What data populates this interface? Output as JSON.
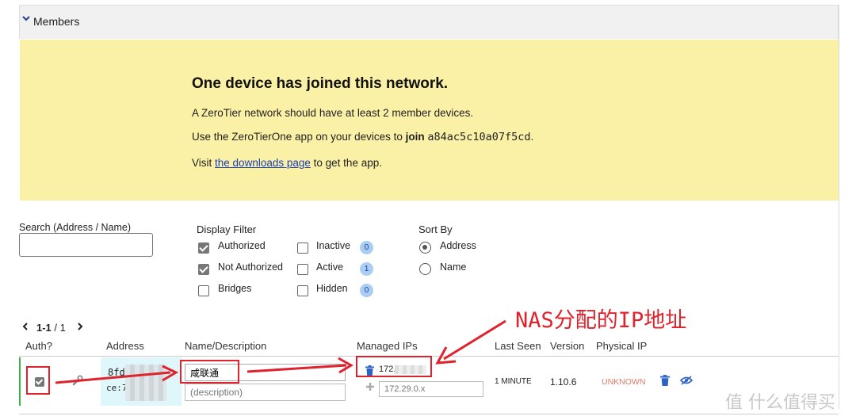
{
  "section": {
    "title": "Members"
  },
  "banner": {
    "title": "One device has joined this network.",
    "line1": "A ZeroTier network should have at least 2 member devices.",
    "line2_prefix": "Use the ZeroTierOne app on your devices to",
    "line2_join": "join",
    "line2_id": "a84ac5c10a07f5cd",
    "line2_suffix": ".",
    "line3_prefix": "Visit",
    "line3_link": "the downloads page",
    "line3_suffix": "to get the app."
  },
  "search": {
    "label": "Search (Address / Name)",
    "value": ""
  },
  "display_filter": {
    "title": "Display Filter",
    "authorized": "Authorized",
    "not_authorized": "Not Authorized",
    "bridges": "Bridges",
    "inactive": "Inactive",
    "inactive_count": "0",
    "active": "Active",
    "active_count": "1",
    "hidden": "Hidden",
    "hidden_count": "0"
  },
  "sort_by": {
    "title": "Sort By",
    "address": "Address",
    "name": "Name"
  },
  "pager": {
    "range": "1-1",
    "total": "/ 1"
  },
  "table": {
    "headers": {
      "auth": "Auth?",
      "address": "Address",
      "name": "Name/Description",
      "managed_ips": "Managed IPs",
      "last_seen": "Last Seen",
      "version": "Version",
      "physical_ip": "Physical IP"
    },
    "row": {
      "address_line1": "8fd",
      "address_line2": "ce:7a",
      "name": "咸联通",
      "description_placeholder": "(description)",
      "managed_ip": "172.",
      "ip_placeholder": "172.29.0.x",
      "last_seen": "1 MINUTE",
      "version": "1.10.6",
      "physical_ip": "UNKNOWN"
    }
  },
  "annotation": {
    "text": "NAS分配的IP地址"
  },
  "watermark": {
    "text": "值 什么值得买"
  },
  "colors": {
    "banner": "#faf0a6",
    "annotation": "#e0222c",
    "active_bar": "#3cb04a",
    "link": "#1a3fb8",
    "unknown": "#e07b6a"
  }
}
